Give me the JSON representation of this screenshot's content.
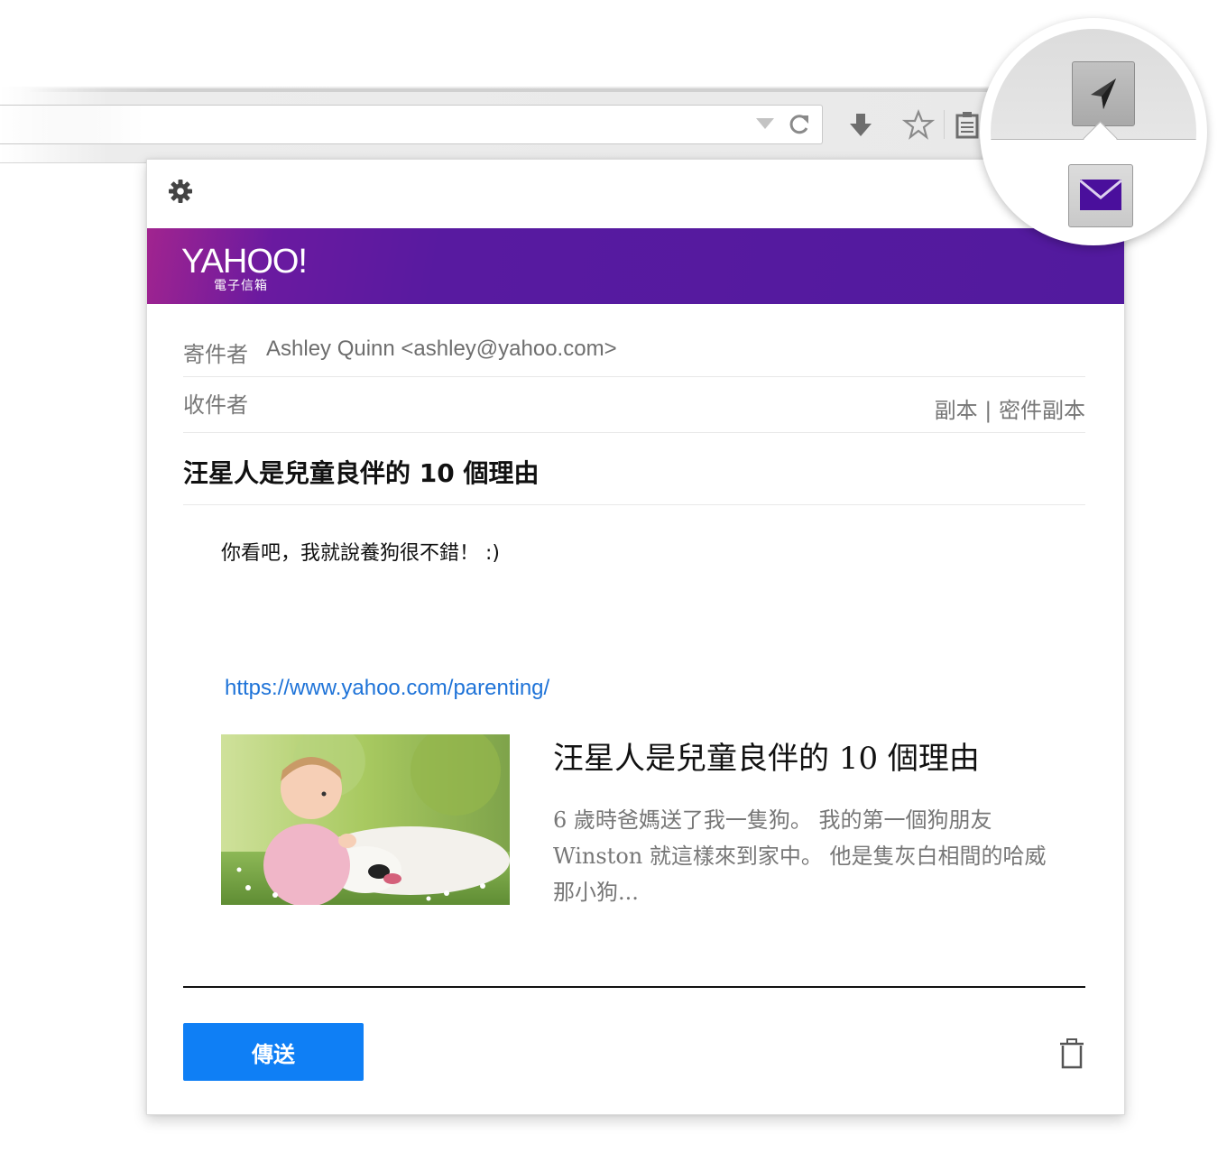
{
  "browser": {
    "icons": [
      "dropdown-arrow-icon",
      "reload-icon",
      "download-icon",
      "bookmark-star-icon",
      "clipboard-icon"
    ]
  },
  "extension": {
    "icons": [
      "send-plane-icon",
      "mail-envelope-icon"
    ],
    "accent": "#4a0f9c"
  },
  "panel": {
    "settings_icon": "gear-icon",
    "brand": {
      "logo": "YAHOO!",
      "sub": "電子信箱",
      "color": "#521a9e"
    },
    "from": {
      "label": "寄件者",
      "value": "Ashley Quinn <ashley@yahoo.com>"
    },
    "to": {
      "label": "收件者",
      "cc_bcc": "副本 | 密件副本"
    },
    "subject": "汪星人是兒童良伴的 10 個理由",
    "message": "你看吧，我就說養狗很不錯！ :)",
    "link_url": "https://www.yahoo.com/parenting/",
    "card": {
      "title": "汪星人是兒童良伴的 10 個理由",
      "description": "6 歲時爸媽送了我一隻狗。 我的第一個狗朋友 Winston 就這樣來到家中。 他是隻灰白相間的哈威那小狗...",
      "image": "baby-with-dog-photo"
    },
    "send_label": "傳送",
    "send_color": "#0f7ff5",
    "delete_icon": "trash-icon"
  }
}
